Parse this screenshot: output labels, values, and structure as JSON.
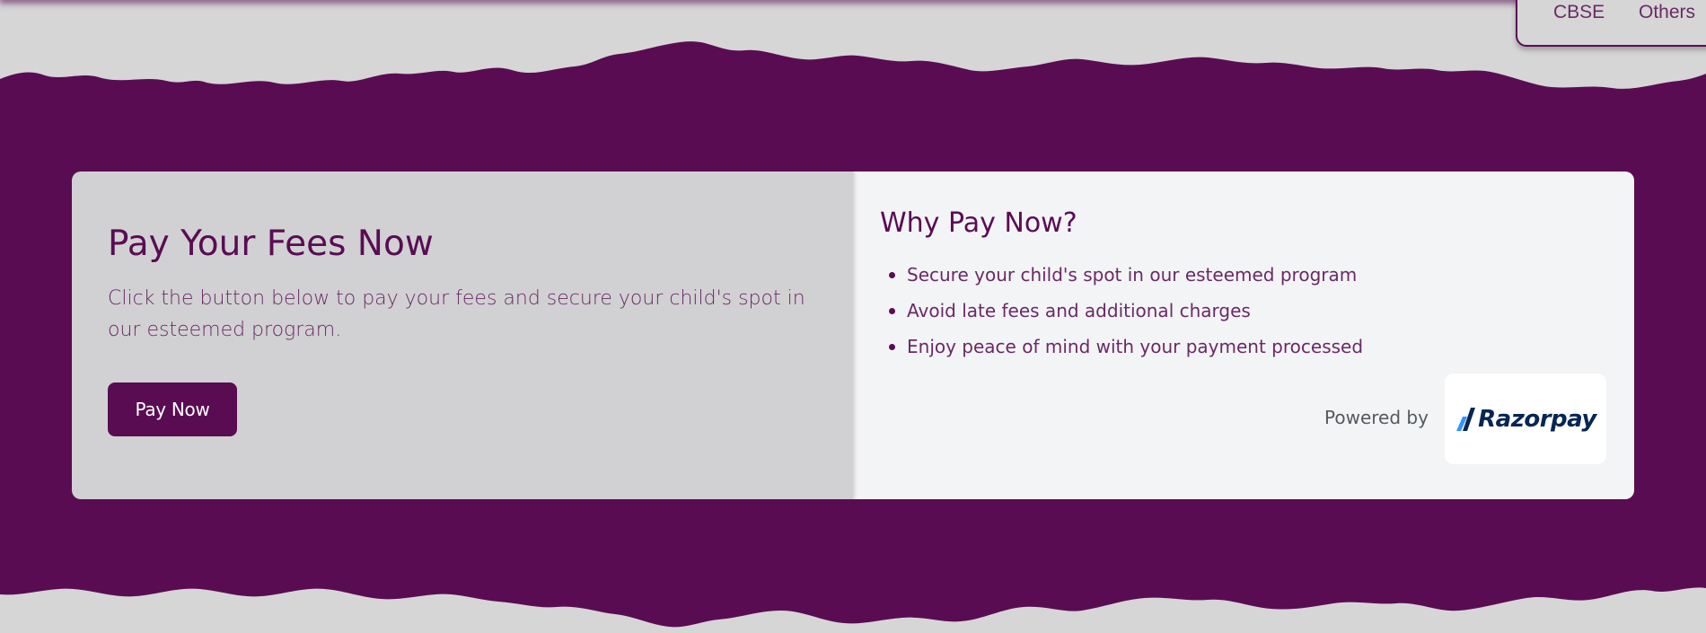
{
  "nav": {
    "items": [
      {
        "label": "CBSE"
      },
      {
        "label": "Others"
      }
    ]
  },
  "colors": {
    "brand_purple": "#5a0c53",
    "page_bg": "#d6d6d6",
    "left_panel_bg": "#d1d1d3",
    "right_panel_bg": "#f3f4f6",
    "razorpay_navy": "#072654",
    "razorpay_blue": "#3395ff"
  },
  "pay_section": {
    "title": "Pay Your Fees Now",
    "description": "Click the button below to pay your fees and secure your child's spot in our esteemed program.",
    "button_label": "Pay Now"
  },
  "why_section": {
    "title": "Why Pay Now?",
    "items": [
      {
        "text": "Secure your child's spot in our esteemed program"
      },
      {
        "text": "Avoid late fees and additional charges"
      },
      {
        "text": "Enjoy peace of mind with your payment processed"
      }
    ]
  },
  "payment_provider": {
    "powered_by_label": "Powered by",
    "name": "Razorpay",
    "logo_icon": "razorpay-logo-icon"
  }
}
